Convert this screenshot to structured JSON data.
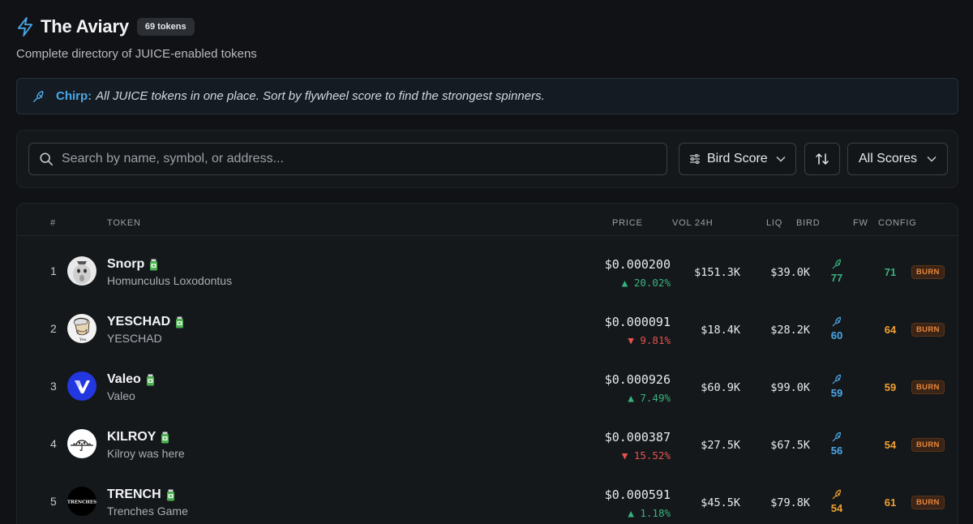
{
  "header": {
    "title": "The Aviary",
    "token_count": "69 tokens",
    "subtitle": "Complete directory of JUICE-enabled tokens"
  },
  "banner": {
    "label": "Chirp:",
    "text": "All JUICE tokens in one place. Sort by flywheel score to find the strongest spinners."
  },
  "toolbar": {
    "search_placeholder": "Search by name, symbol, or address...",
    "sort_label": "Bird Score",
    "filter_label": "All Scores"
  },
  "table": {
    "columns": {
      "rank": "#",
      "token": "TOKEN",
      "price": "PRICE",
      "vol": "VOL 24H",
      "liq": "LIQ",
      "bird": "BIRD",
      "fw": "FW",
      "config": "CONFIG"
    },
    "rows": [
      {
        "rank": "1",
        "symbol": "Snorp",
        "name": "Homunculus Loxodontus",
        "price": "$0.000200",
        "change": "▲ 20.02%",
        "direction": "up",
        "vol": "$151.3K",
        "liq": "$39.0K",
        "bird": "77",
        "bird_color": "#36b37e",
        "fw": "71",
        "fw_color": "#36b37e",
        "config": "BURN",
        "avatar": "snorp"
      },
      {
        "rank": "2",
        "symbol": "YESCHAD",
        "name": "YESCHAD",
        "price": "$0.000091",
        "change": "▼ 9.81%",
        "direction": "down",
        "vol": "$18.4K",
        "liq": "$28.2K",
        "bird": "60",
        "bird_color": "#4aa8e8",
        "fw": "64",
        "fw_color": "#f0a030",
        "config": "BURN",
        "avatar": "yeschad"
      },
      {
        "rank": "3",
        "symbol": "Valeo",
        "name": "Valeo",
        "price": "$0.000926",
        "change": "▲ 7.49%",
        "direction": "up",
        "vol": "$60.9K",
        "liq": "$99.0K",
        "bird": "59",
        "bird_color": "#4aa8e8",
        "fw": "59",
        "fw_color": "#f0a030",
        "config": "BURN",
        "avatar": "valeo"
      },
      {
        "rank": "4",
        "symbol": "KILROY",
        "name": "Kilroy was here",
        "price": "$0.000387",
        "change": "▼ 15.52%",
        "direction": "down",
        "vol": "$27.5K",
        "liq": "$67.5K",
        "bird": "56",
        "bird_color": "#4aa8e8",
        "fw": "54",
        "fw_color": "#f0a030",
        "config": "BURN",
        "avatar": "kilroy"
      },
      {
        "rank": "5",
        "symbol": "TRENCH",
        "name": "Trenches Game",
        "price": "$0.000591",
        "change": "▲ 1.18%",
        "direction": "up",
        "vol": "$45.5K",
        "liq": "$79.8K",
        "bird": "54",
        "bird_color": "#f0a030",
        "fw": "61",
        "fw_color": "#f0a030",
        "config": "BURN",
        "avatar": "trench",
        "avatar_text": "TRENCHES"
      }
    ]
  },
  "colors": {
    "accent_blue": "#4aa8e8",
    "up_green": "#36b37e",
    "down_red": "#e5534b",
    "score_orange": "#f0a030",
    "burn_orange": "#e8863a"
  }
}
